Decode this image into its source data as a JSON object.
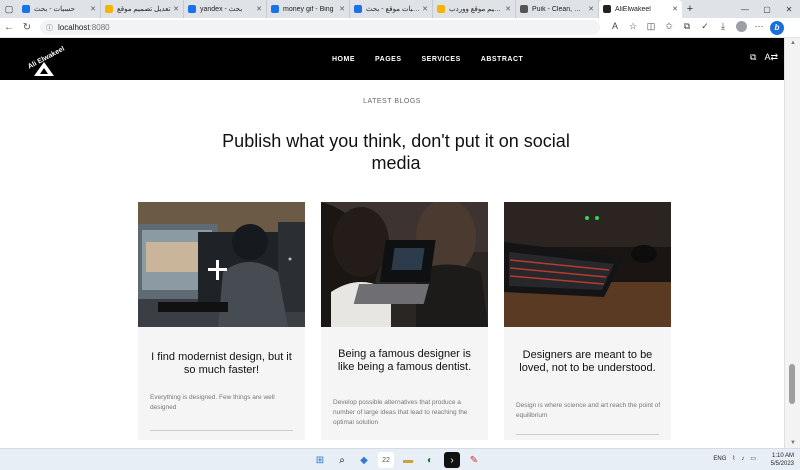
{
  "browser": {
    "tabs": [
      {
        "label": "حسبات - بحث",
        "color": "#1a73e8",
        "active": false
      },
      {
        "label": "تعديل تصميم موقع",
        "color": "#f4b400",
        "active": false
      },
      {
        "label": "yandex - بحث",
        "color": "#1a73e8",
        "active": false
      },
      {
        "label": "money gif - Bing",
        "color": "#1a73e8",
        "active": false
      },
      {
        "label": "حسبات موقع - بحث",
        "color": "#1a73e8",
        "active": false
      },
      {
        "label": "تصميم موقع ووردب",
        "color": "#f4b400",
        "active": false
      },
      {
        "label": "Puik - Clean, Mini",
        "color": "#555",
        "active": false
      },
      {
        "label": "AliElwakeel",
        "color": "#222",
        "active": true
      }
    ],
    "url_host": "localhost",
    "url_port": ":8080"
  },
  "site": {
    "logo_text": "Ali Elwakeel",
    "nav": [
      "HOME",
      "PAGES",
      "SERVICES",
      "ABSTRACT"
    ],
    "eyebrow": "LATEST BLOGS",
    "headline": "Publish what you think, don't put it on social media",
    "cards": [
      {
        "title": "I find modernist design, but it so much faster!",
        "text": "Everything is designed. Few things are well designed"
      },
      {
        "title": "Being a famous designer is like being a famous dentist.",
        "text": "Develop possible alternatives that produce a number of large ideas that lead to reaching the optimal solution"
      },
      {
        "title": "Designers are meant to be loved, not to be understood.",
        "text": "Design is where science and art reach the point of equilibrium"
      }
    ]
  },
  "taskbar": {
    "lang": "ENG",
    "time": "1:10 AM",
    "date": "5/5/2023",
    "badge": "22"
  },
  "icons": {
    "back": "back-arrow-icon",
    "refresh": "refresh-icon",
    "lock": "info-icon",
    "windows": "windows-start-icon",
    "search": "search-icon"
  }
}
